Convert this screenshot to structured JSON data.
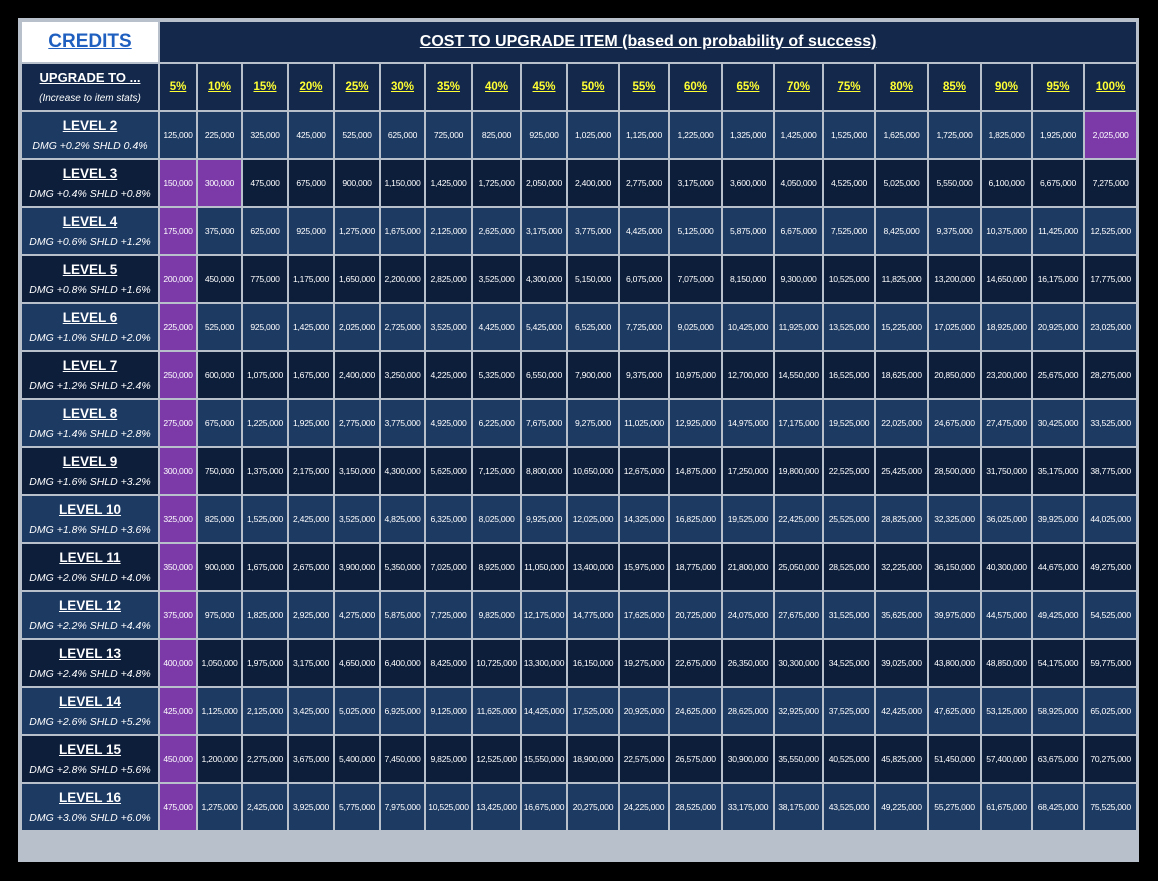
{
  "header": {
    "credits_label": "CREDITS",
    "title": "COST TO UPGRADE ITEM (based on probability of success)",
    "upgrade_label": "UPGRADE TO ...",
    "upgrade_sub": "(Increase to item stats)"
  },
  "colors": {
    "highlight": "#7b3aa8",
    "header_bg": "#13284a",
    "percent_text": "#ffff33"
  },
  "percentages": [
    "5%",
    "10%",
    "15%",
    "20%",
    "25%",
    "30%",
    "35%",
    "40%",
    "45%",
    "50%",
    "55%",
    "60%",
    "65%",
    "70%",
    "75%",
    "80%",
    "85%",
    "90%",
    "95%",
    "100%"
  ],
  "levels": [
    {
      "name": "LEVEL 2",
      "stats": "DMG +0.2%  SHLD 0.4%",
      "values": [
        "125,000",
        "225,000",
        "325,000",
        "425,000",
        "525,000",
        "625,000",
        "725,000",
        "825,000",
        "925,000",
        "1,025,000",
        "1,125,000",
        "1,225,000",
        "1,325,000",
        "1,425,000",
        "1,525,000",
        "1,625,000",
        "1,725,000",
        "1,825,000",
        "1,925,000",
        "2,025,000"
      ],
      "highlight": [
        19
      ]
    },
    {
      "name": "LEVEL 3",
      "stats": "DMG +0.4%  SHLD +0.8%",
      "values": [
        "150,000",
        "300,000",
        "475,000",
        "675,000",
        "900,000",
        "1,150,000",
        "1,425,000",
        "1,725,000",
        "2,050,000",
        "2,400,000",
        "2,775,000",
        "3,175,000",
        "3,600,000",
        "4,050,000",
        "4,525,000",
        "5,025,000",
        "5,550,000",
        "6,100,000",
        "6,675,000",
        "7,275,000"
      ],
      "highlight": [
        0,
        1
      ]
    },
    {
      "name": "LEVEL 4",
      "stats": "DMG +0.6%  SHLD +1.2%",
      "values": [
        "175,000",
        "375,000",
        "625,000",
        "925,000",
        "1,275,000",
        "1,675,000",
        "2,125,000",
        "2,625,000",
        "3,175,000",
        "3,775,000",
        "4,425,000",
        "5,125,000",
        "5,875,000",
        "6,675,000",
        "7,525,000",
        "8,425,000",
        "9,375,000",
        "10,375,000",
        "11,425,000",
        "12,525,000"
      ],
      "highlight": [
        0
      ]
    },
    {
      "name": "LEVEL 5",
      "stats": "DMG +0.8%  SHLD +1.6%",
      "values": [
        "200,000",
        "450,000",
        "775,000",
        "1,175,000",
        "1,650,000",
        "2,200,000",
        "2,825,000",
        "3,525,000",
        "4,300,000",
        "5,150,000",
        "6,075,000",
        "7,075,000",
        "8,150,000",
        "9,300,000",
        "10,525,000",
        "11,825,000",
        "13,200,000",
        "14,650,000",
        "16,175,000",
        "17,775,000"
      ],
      "highlight": [
        0
      ]
    },
    {
      "name": "LEVEL 6",
      "stats": "DMG +1.0%  SHLD +2.0%",
      "values": [
        "225,000",
        "525,000",
        "925,000",
        "1,425,000",
        "2,025,000",
        "2,725,000",
        "3,525,000",
        "4,425,000",
        "5,425,000",
        "6,525,000",
        "7,725,000",
        "9,025,000",
        "10,425,000",
        "11,925,000",
        "13,525,000",
        "15,225,000",
        "17,025,000",
        "18,925,000",
        "20,925,000",
        "23,025,000"
      ],
      "highlight": [
        0
      ]
    },
    {
      "name": "LEVEL 7",
      "stats": "DMG +1.2%  SHLD +2.4%",
      "values": [
        "250,000",
        "600,000",
        "1,075,000",
        "1,675,000",
        "2,400,000",
        "3,250,000",
        "4,225,000",
        "5,325,000",
        "6,550,000",
        "7,900,000",
        "9,375,000",
        "10,975,000",
        "12,700,000",
        "14,550,000",
        "16,525,000",
        "18,625,000",
        "20,850,000",
        "23,200,000",
        "25,675,000",
        "28,275,000"
      ],
      "highlight": [
        0
      ]
    },
    {
      "name": "LEVEL 8",
      "stats": "DMG +1.4%  SHLD +2.8%",
      "values": [
        "275,000",
        "675,000",
        "1,225,000",
        "1,925,000",
        "2,775,000",
        "3,775,000",
        "4,925,000",
        "6,225,000",
        "7,675,000",
        "9,275,000",
        "11,025,000",
        "12,925,000",
        "14,975,000",
        "17,175,000",
        "19,525,000",
        "22,025,000",
        "24,675,000",
        "27,475,000",
        "30,425,000",
        "33,525,000"
      ],
      "highlight": [
        0
      ]
    },
    {
      "name": "LEVEL 9",
      "stats": "DMG +1.6%  SHLD +3.2%",
      "values": [
        "300,000",
        "750,000",
        "1,375,000",
        "2,175,000",
        "3,150,000",
        "4,300,000",
        "5,625,000",
        "7,125,000",
        "8,800,000",
        "10,650,000",
        "12,675,000",
        "14,875,000",
        "17,250,000",
        "19,800,000",
        "22,525,000",
        "25,425,000",
        "28,500,000",
        "31,750,000",
        "35,175,000",
        "38,775,000"
      ],
      "highlight": [
        0
      ]
    },
    {
      "name": "LEVEL 10",
      "stats": "DMG +1.8%  SHLD +3.6%",
      "values": [
        "325,000",
        "825,000",
        "1,525,000",
        "2,425,000",
        "3,525,000",
        "4,825,000",
        "6,325,000",
        "8,025,000",
        "9,925,000",
        "12,025,000",
        "14,325,000",
        "16,825,000",
        "19,525,000",
        "22,425,000",
        "25,525,000",
        "28,825,000",
        "32,325,000",
        "36,025,000",
        "39,925,000",
        "44,025,000"
      ],
      "highlight": [
        0
      ]
    },
    {
      "name": "LEVEL 11",
      "stats": "DMG +2.0%  SHLD +4.0%",
      "values": [
        "350,000",
        "900,000",
        "1,675,000",
        "2,675,000",
        "3,900,000",
        "5,350,000",
        "7,025,000",
        "8,925,000",
        "11,050,000",
        "13,400,000",
        "15,975,000",
        "18,775,000",
        "21,800,000",
        "25,050,000",
        "28,525,000",
        "32,225,000",
        "36,150,000",
        "40,300,000",
        "44,675,000",
        "49,275,000"
      ],
      "highlight": [
        0
      ]
    },
    {
      "name": "LEVEL 12",
      "stats": "DMG +2.2%  SHLD +4.4%",
      "values": [
        "375,000",
        "975,000",
        "1,825,000",
        "2,925,000",
        "4,275,000",
        "5,875,000",
        "7,725,000",
        "9,825,000",
        "12,175,000",
        "14,775,000",
        "17,625,000",
        "20,725,000",
        "24,075,000",
        "27,675,000",
        "31,525,000",
        "35,625,000",
        "39,975,000",
        "44,575,000",
        "49,425,000",
        "54,525,000"
      ],
      "highlight": [
        0
      ]
    },
    {
      "name": "LEVEL 13",
      "stats": "DMG +2.4%  SHLD +4.8%",
      "values": [
        "400,000",
        "1,050,000",
        "1,975,000",
        "3,175,000",
        "4,650,000",
        "6,400,000",
        "8,425,000",
        "10,725,000",
        "13,300,000",
        "16,150,000",
        "19,275,000",
        "22,675,000",
        "26,350,000",
        "30,300,000",
        "34,525,000",
        "39,025,000",
        "43,800,000",
        "48,850,000",
        "54,175,000",
        "59,775,000"
      ],
      "highlight": [
        0
      ]
    },
    {
      "name": "LEVEL 14",
      "stats": "DMG +2.6%  SHLD +5.2%",
      "values": [
        "425,000",
        "1,125,000",
        "2,125,000",
        "3,425,000",
        "5,025,000",
        "6,925,000",
        "9,125,000",
        "11,625,000",
        "14,425,000",
        "17,525,000",
        "20,925,000",
        "24,625,000",
        "28,625,000",
        "32,925,000",
        "37,525,000",
        "42,425,000",
        "47,625,000",
        "53,125,000",
        "58,925,000",
        "65,025,000"
      ],
      "highlight": [
        0
      ]
    },
    {
      "name": "LEVEL 15",
      "stats": "DMG +2.8%  SHLD +5.6%",
      "values": [
        "450,000",
        "1,200,000",
        "2,275,000",
        "3,675,000",
        "5,400,000",
        "7,450,000",
        "9,825,000",
        "12,525,000",
        "15,550,000",
        "18,900,000",
        "22,575,000",
        "26,575,000",
        "30,900,000",
        "35,550,000",
        "40,525,000",
        "45,825,000",
        "51,450,000",
        "57,400,000",
        "63,675,000",
        "70,275,000"
      ],
      "highlight": [
        0
      ]
    },
    {
      "name": "LEVEL 16",
      "stats": "DMG +3.0%  SHLD +6.0%",
      "values": [
        "475,000",
        "1,275,000",
        "2,425,000",
        "3,925,000",
        "5,775,000",
        "7,975,000",
        "10,525,000",
        "13,425,000",
        "16,675,000",
        "20,275,000",
        "24,225,000",
        "28,525,000",
        "33,175,000",
        "38,175,000",
        "43,525,000",
        "49,225,000",
        "55,275,000",
        "61,675,000",
        "68,425,000",
        "75,525,000"
      ],
      "highlight": [
        0
      ]
    }
  ]
}
